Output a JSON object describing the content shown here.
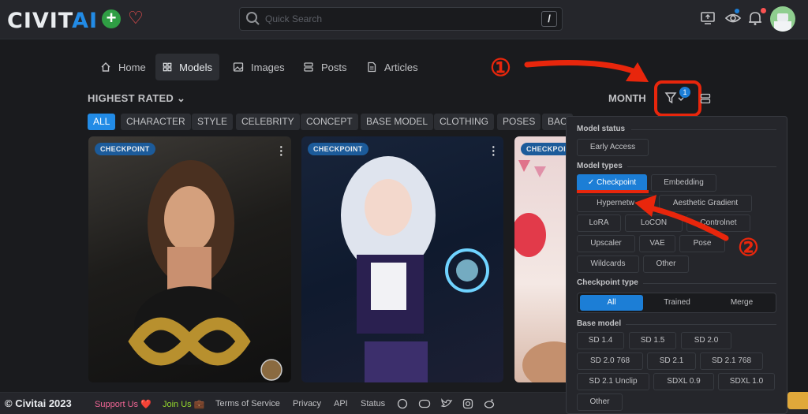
{
  "header": {
    "logo_main": "CIVIT",
    "logo_ai": "AI",
    "search_placeholder": "Quick Search",
    "search_shortcut": "/"
  },
  "nav": [
    "Home",
    "Models",
    "Images",
    "Posts",
    "Articles"
  ],
  "sort_label": "HIGHEST RATED",
  "period_label": "MONTH",
  "filter_count": "1",
  "categories": [
    "ALL",
    "CHARACTER",
    "STYLE",
    "CELEBRITY",
    "CONCEPT",
    "BASE MODEL",
    "CLOTHING",
    "POSES",
    "BAC"
  ],
  "cards": [
    {
      "badge": "CHECKPOINT"
    },
    {
      "badge": "CHECKPOINT"
    },
    {
      "badge": "CHECKPOINT"
    }
  ],
  "filters": {
    "model_status": {
      "title": "Model status",
      "options": [
        "Early Access"
      ]
    },
    "model_types": {
      "title": "Model types",
      "options": [
        "Checkpoint",
        "Embedding",
        "Hypernetw",
        "Aesthetic Gradient",
        "LoRA",
        "LoCON",
        "Controlnet",
        "Upscaler",
        "VAE",
        "Pose",
        "Wildcards",
        "Other"
      ],
      "selected": "Checkpoint"
    },
    "checkpoint_type": {
      "title": "Checkpoint type",
      "options": [
        "All",
        "Trained",
        "Merge"
      ],
      "selected": "All"
    },
    "base_model": {
      "title": "Base model",
      "options": [
        "SD 1.4",
        "SD 1.5",
        "SD 2.0",
        "SD 2.0 768",
        "SD 2.1",
        "SD 2.1 768",
        "SD 2.1 Unclip",
        "SDXL 0.9",
        "SDXL 1.0",
        "Other"
      ]
    }
  },
  "annotations": {
    "step1": "①",
    "step2": "②"
  },
  "footer": {
    "copyright": "© Civitai 2023",
    "links": [
      "Support Us ❤️",
      "Join Us 💼",
      "Terms of Service",
      "Privacy",
      "API",
      "Status"
    ]
  },
  "colors": {
    "accent": "#228be6",
    "annotation": "#e8260c"
  }
}
